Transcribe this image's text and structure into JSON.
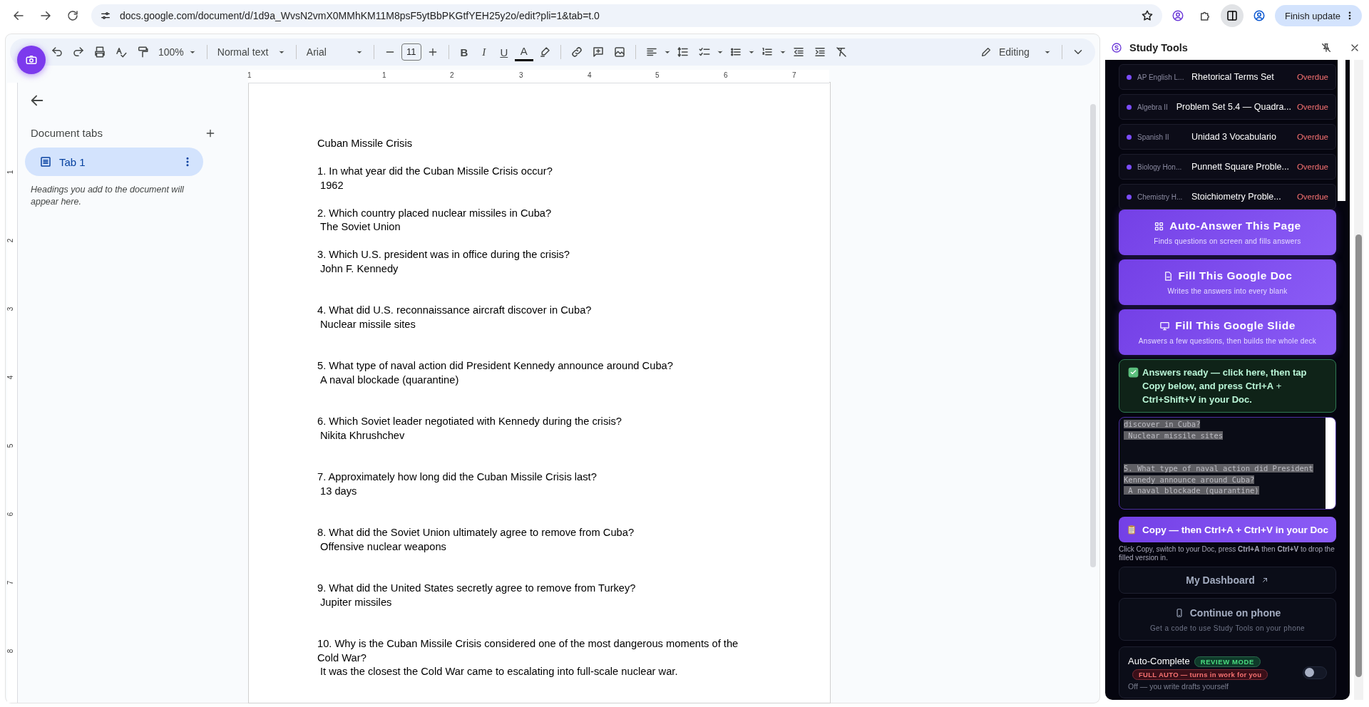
{
  "browser": {
    "url": "docs.google.com/document/d/1d9a_WvsN2vmX0MMhKM11M8psF5ytBbPKGtfYEH25y2o/edit?pli=1&tab=t.0",
    "update_button": "Finish update"
  },
  "toolbar": {
    "zoom": "100%",
    "style": "Normal text",
    "font": "Arial",
    "font_size": "11",
    "bold": "B",
    "italic": "I",
    "underline": "U",
    "text_color": "A",
    "mode": "Editing"
  },
  "ruler": {
    "top_labels": [
      "1",
      "1",
      "2",
      "3",
      "4",
      "5",
      "6",
      "7"
    ],
    "left_labels": [
      "1",
      "2",
      "3",
      "4",
      "5",
      "6",
      "7",
      "8"
    ]
  },
  "outline": {
    "heading": "Document tabs",
    "tabs": [
      {
        "label": "Tab 1",
        "selected": true
      }
    ],
    "hint": "Headings you add to the document will appear here."
  },
  "document": {
    "title": "Cuban Missile Crisis",
    "questions": [
      {
        "question": "1. In what year did the Cuban Missile Crisis occur?",
        "answer": "1962"
      },
      {
        "question": "2. Which country placed nuclear missiles in Cuba?",
        "answer": "The Soviet Union"
      },
      {
        "question": "3. Which U.S. president was in office during the crisis?",
        "answer": "John F. Kennedy"
      },
      {
        "question": "4. What did U.S. reconnaissance aircraft discover in Cuba?",
        "answer": "Nuclear missile sites"
      },
      {
        "question": "5. What type of naval action did President Kennedy announce around Cuba?",
        "answer": "A naval blockade (quarantine)"
      },
      {
        "question": "6. Which Soviet leader negotiated with Kennedy during the crisis?",
        "answer": "Nikita Khrushchev"
      },
      {
        "question": "7. Approximately how long did the Cuban Missile Crisis last?",
        "answer": "13 days"
      },
      {
        "question": "8. What did the Soviet Union ultimately agree to remove from Cuba?",
        "answer": "Offensive nuclear weapons"
      },
      {
        "question": "9. What did the United States secretly agree to remove from Turkey?",
        "answer": "Jupiter missiles"
      },
      {
        "question": "10. Why is the Cuban Missile Crisis considered one of the most dangerous moments of the Cold War?",
        "answer": "It was the closest the Cold War came to escalating into full-scale nuclear war."
      }
    ]
  },
  "study_tools": {
    "title": "Study Tools",
    "assignments": [
      {
        "subject": "AP English L...",
        "title": "Rhetorical Terms Set",
        "status": "Overdue"
      },
      {
        "subject": "Algebra II",
        "title": "Problem Set 5.4 — Quadra...",
        "status": "Overdue"
      },
      {
        "subject": "Spanish II",
        "title": "Unidad 3 Vocabulario",
        "status": "Overdue"
      },
      {
        "subject": "Biology Hon...",
        "title": "Punnett Square Proble...",
        "status": "Overdue"
      },
      {
        "subject": "Chemistry H...",
        "title": "Stoichiometry Proble...",
        "status": "Overdue"
      }
    ],
    "actions": [
      {
        "kind": "grid",
        "title": "Auto-Answer This Page",
        "subtitle": "Finds questions on screen and fills answers"
      },
      {
        "kind": "doc",
        "title": "Fill This Google Doc",
        "subtitle": "Writes the answers into every blank"
      },
      {
        "kind": "monitor",
        "title": "Fill This Google Slide",
        "subtitle": "Answers a few questions, then builds the whole deck"
      }
    ],
    "notice": "**Answers ready — click here, then tap Copy below, and press Ctrl+A** + **Ctrl+Shift+V in your Doc.**",
    "answer_text": "discover in Cuba?\n Nuclear missile sites\n\n\n5. What type of naval action did President\nKennedy announce around Cuba?\n A naval blockade (quarantine)",
    "copy_button": "Copy — then Ctrl+A + Ctrl+V in your Doc",
    "copy_note": "Click Copy, switch to your Doc, press **Ctrl+A** then **Ctrl+V** to drop the filled version in.",
    "dashboard": "My Dashboard",
    "phone": {
      "title": "Continue on phone",
      "subtitle": "Get a code to use Study Tools on your phone"
    },
    "auto_complete": {
      "label": "Auto-Complete",
      "review_badge": "REVIEW MODE",
      "full_badge": "FULL AUTO — turns in work for you",
      "caption": "Off — you write drafts yourself",
      "on": false
    }
  }
}
